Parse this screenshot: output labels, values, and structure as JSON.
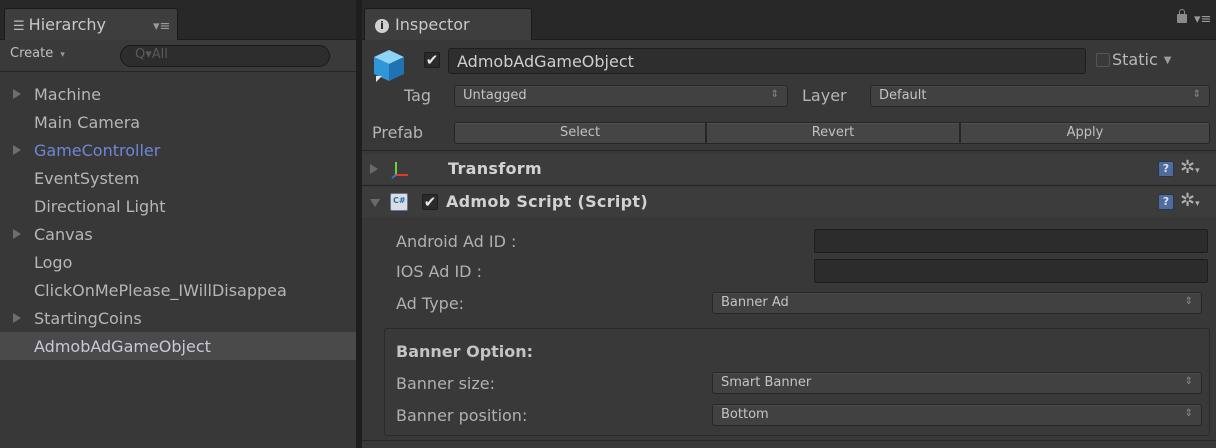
{
  "hierarchy": {
    "tab_title": "Hierarchy",
    "menu_glyph": "▾≡",
    "create_label": "Create",
    "create_caret": "▾",
    "search_placeholder": "Q▾All",
    "items": [
      {
        "label": "Machine",
        "expandable": true
      },
      {
        "label": "Main Camera",
        "expandable": false
      },
      {
        "label": "GameController",
        "expandable": true,
        "color": "#6f86d6"
      },
      {
        "label": "EventSystem",
        "expandable": false
      },
      {
        "label": "Directional Light",
        "expandable": false
      },
      {
        "label": "Canvas",
        "expandable": true
      },
      {
        "label": "Logo",
        "expandable": false
      },
      {
        "label": "ClickOnMePlease_IWillDisappea",
        "expandable": false
      },
      {
        "label": "StartingCoins",
        "expandable": true
      },
      {
        "label": "AdmobAdGameObject",
        "expandable": false,
        "selected": true
      }
    ]
  },
  "inspector": {
    "tab_title": "Inspector",
    "menu_glyph": "▾≡",
    "gameobject": {
      "active_check": "✔",
      "name": "AdmobAdGameObject",
      "static_label": "Static",
      "static_caret": "▼"
    },
    "tag": {
      "label": "Tag",
      "value": "Untagged"
    },
    "layer": {
      "label": "Layer",
      "value": "Default"
    },
    "prefab": {
      "label": "Prefab",
      "select": "Select",
      "revert": "Revert",
      "apply": "Apply"
    },
    "transform": {
      "title": "Transform"
    },
    "admob_script": {
      "enabled_check": "✔",
      "title": "Admob Script (Script)",
      "android_label": "Android Ad ID :",
      "android_value": "",
      "ios_label": "IOS Ad ID :",
      "ios_value": "",
      "ad_type_label": "Ad Type:",
      "ad_type_value": "Banner Ad",
      "banner_header": "Banner Option:",
      "banner_size_label": "Banner size:",
      "banner_size_value": "Smart Banner",
      "banner_position_label": "Banner position:",
      "banner_position_value": "Bottom"
    }
  },
  "glyphs": {
    "help": "?",
    "gear": "✲",
    "dropdown_arrow": "⇕"
  },
  "colors": {
    "accent_blue": "#6f86d6",
    "panel_bg": "#383838",
    "tab_bg": "#282828"
  }
}
